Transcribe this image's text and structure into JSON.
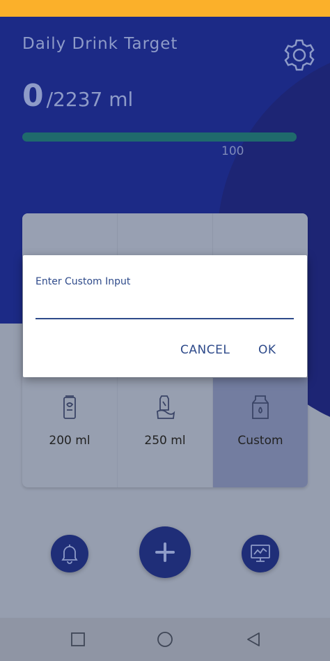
{
  "header": {
    "title": "Daily Drink Target",
    "current_intake": "0",
    "target_intake": "/2237 ml",
    "progress_label": "100",
    "progress_fraction": 1.0
  },
  "drinks": [
    {
      "label": "200 ml",
      "icon": "can-icon"
    },
    {
      "label": "250 ml",
      "icon": "sport-bottle-icon"
    },
    {
      "label": "Custom",
      "icon": "milk-carton-icon"
    }
  ],
  "dialog": {
    "title": "Enter Custom Input",
    "input_value": "",
    "cancel_label": "CANCEL",
    "ok_label": "OK"
  },
  "colors": {
    "status_bar": "#fbb02a",
    "header": "#1c2a86",
    "accent": "#2e4a8a",
    "progress": "#1f6a6c"
  }
}
